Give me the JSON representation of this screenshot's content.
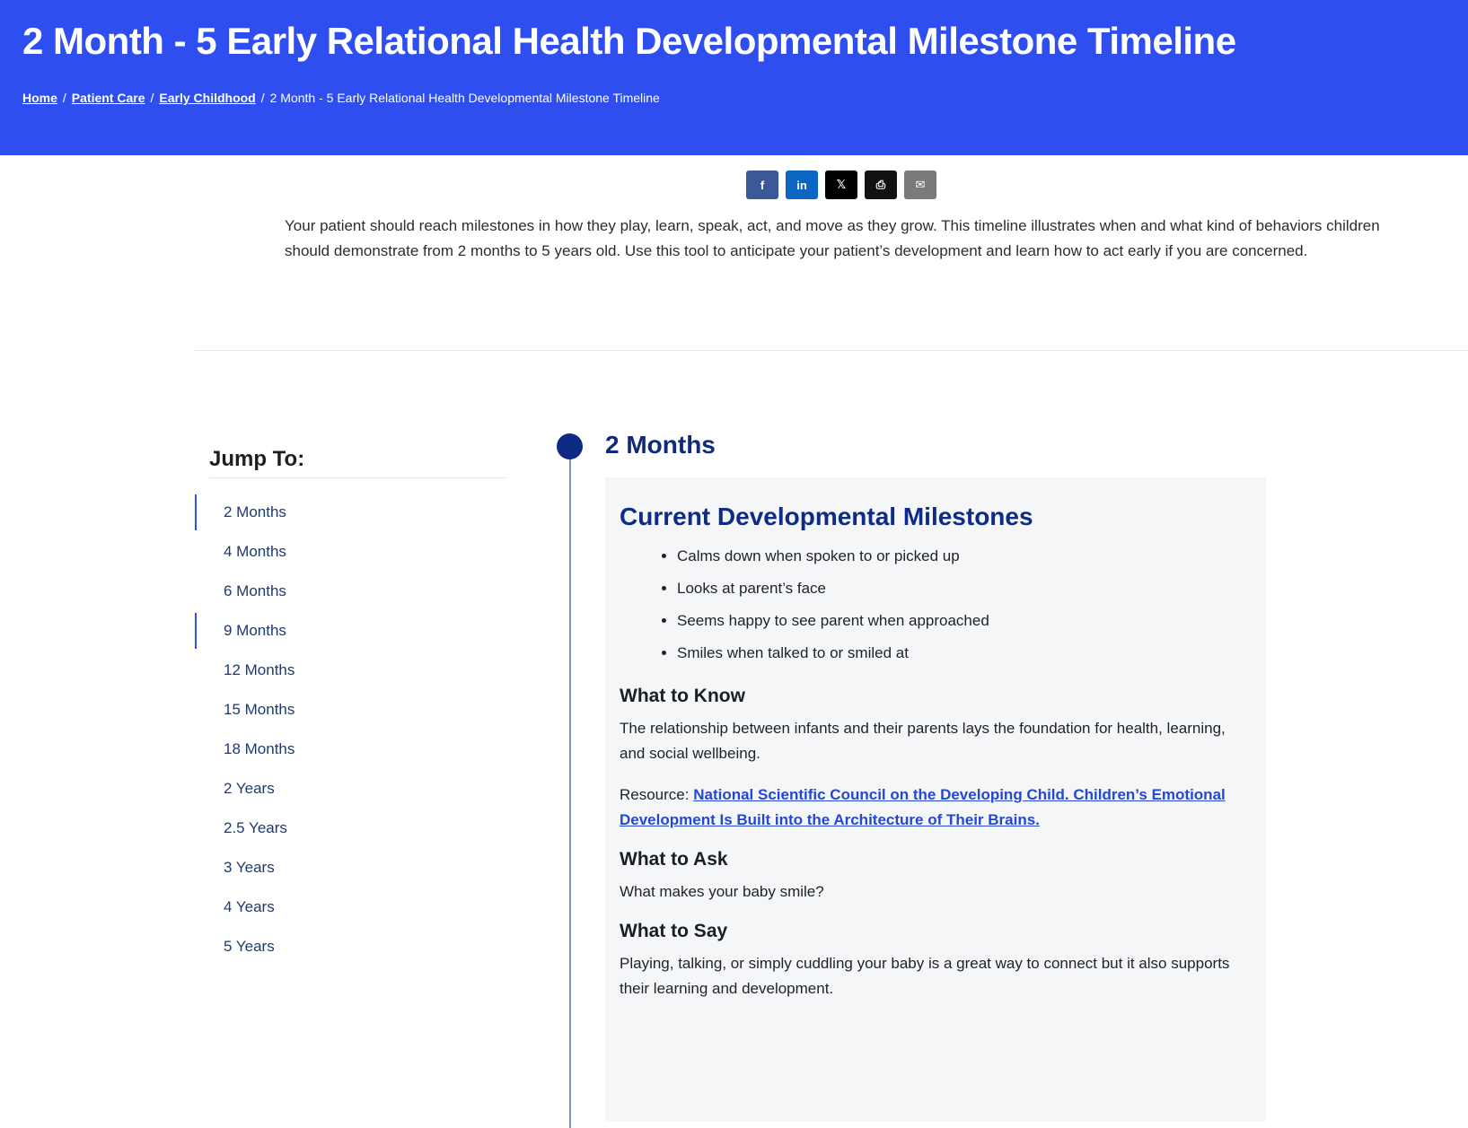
{
  "page": {
    "title": "2 Month - 5 Early Relational Health Developmental Milestone Timeline"
  },
  "breadcrumb": {
    "items": [
      "Home",
      "Patient Care",
      "Early Childhood"
    ],
    "current": "2 Month - 5 Early Relational Health Developmental Milestone Timeline",
    "separator": "/"
  },
  "share": {
    "facebook_glyph": "f",
    "linkedin_glyph": "in",
    "x_glyph": "𝕏",
    "print_glyph": "⎙",
    "email_glyph": "✉"
  },
  "intro": "Your patient should reach milestones in how they play, learn, speak, act, and move as they grow. This timeline illustrates when and what kind of behaviors children should demonstrate from 2 months to 5 years old. Use this tool to anticipate your patient’s development and learn how to act early if you are concerned.",
  "jump_to": {
    "title": "Jump To:",
    "items": [
      "2 Months",
      "4 Months",
      "6 Months",
      "9 Months",
      "12 Months",
      "15 Months",
      "18 Months",
      "2 Years",
      "2.5 Years",
      "3 Years",
      "4 Years",
      "5 Years"
    ]
  },
  "section": {
    "title": "2 Months",
    "milestones_heading": "Current Developmental Milestones",
    "milestones": [
      "Calms down when spoken to or picked up",
      "Looks at parent’s face",
      "Seems happy to see parent when approached",
      "Smiles when talked to or smiled at"
    ],
    "know_heading": "What to Know",
    "know_text": "The relationship between infants and their parents lays the foundation for health, learning, and social wellbeing.",
    "resource_label": "Resource:",
    "resource_link": "National Scientific Council on the Developing Child. Children’s Emotional Development Is Built into the Architecture of Their Brains.",
    "ask_heading": "What to Ask",
    "ask_text": "What makes your baby smile?",
    "say_heading": "What to Say",
    "say_text": "Playing, talking, or simply cuddling your baby is a great way to connect but it also supports their learning and development."
  },
  "colors": {
    "hero": "#2f4ef0",
    "heading_navy": "#0f2b86",
    "link": "#2447d4",
    "card_bg": "#f4f6f8"
  }
}
